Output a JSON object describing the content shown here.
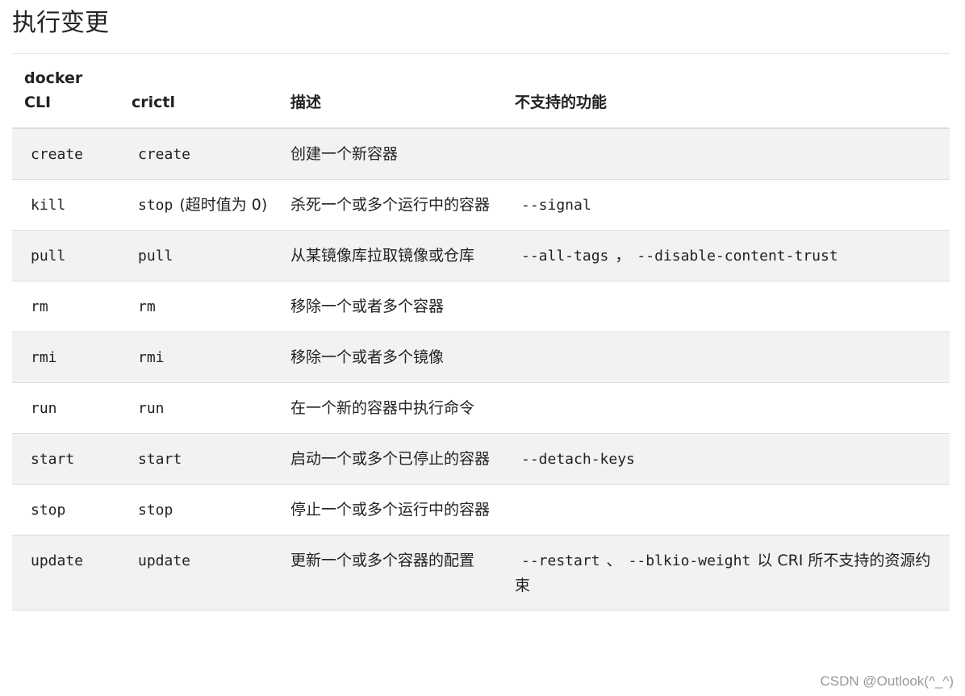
{
  "title": "执行变更",
  "headers": {
    "docker": "docker CLI",
    "crictl": "crictl",
    "desc": "描述",
    "unsupported": "不支持的功能"
  },
  "rows": [
    {
      "docker": "create",
      "crictl": "create",
      "crictl_note": "",
      "desc": "创建一个新容器",
      "unsupported": [],
      "unsupported_note": ""
    },
    {
      "docker": "kill",
      "crictl": "stop",
      "crictl_note": "(超时值为 0)",
      "desc": "杀死一个或多个运行中的容器",
      "unsupported": [
        "--signal"
      ],
      "unsupported_note": ""
    },
    {
      "docker": "pull",
      "crictl": "pull",
      "crictl_note": "",
      "desc": "从某镜像库拉取镜像或仓库",
      "unsupported": [
        "--all-tags",
        "--disable-content-trust"
      ],
      "separator": "，",
      "unsupported_note": ""
    },
    {
      "docker": "rm",
      "crictl": "rm",
      "crictl_note": "",
      "desc": "移除一个或者多个容器",
      "unsupported": [],
      "unsupported_note": ""
    },
    {
      "docker": "rmi",
      "crictl": "rmi",
      "crictl_note": "",
      "desc": "移除一个或者多个镜像",
      "unsupported": [],
      "unsupported_note": ""
    },
    {
      "docker": "run",
      "crictl": "run",
      "crictl_note": "",
      "desc": "在一个新的容器中执行命令",
      "unsupported": [],
      "unsupported_note": ""
    },
    {
      "docker": "start",
      "crictl": "start",
      "crictl_note": "",
      "desc": "启动一个或多个已停止的容器",
      "unsupported": [
        "--detach-keys"
      ],
      "unsupported_note": ""
    },
    {
      "docker": "stop",
      "crictl": "stop",
      "crictl_note": "",
      "desc": "停止一个或多个运行中的容器",
      "unsupported": [],
      "unsupported_note": ""
    },
    {
      "docker": "update",
      "crictl": "update",
      "crictl_note": "",
      "desc": "更新一个或多个容器的配置",
      "unsupported": [
        "--restart",
        "--blkio-weight"
      ],
      "separator": "、",
      "unsupported_note": "以 CRI 所不支持的资源约束"
    }
  ],
  "watermark": "CSDN @Outlook(^_^)"
}
